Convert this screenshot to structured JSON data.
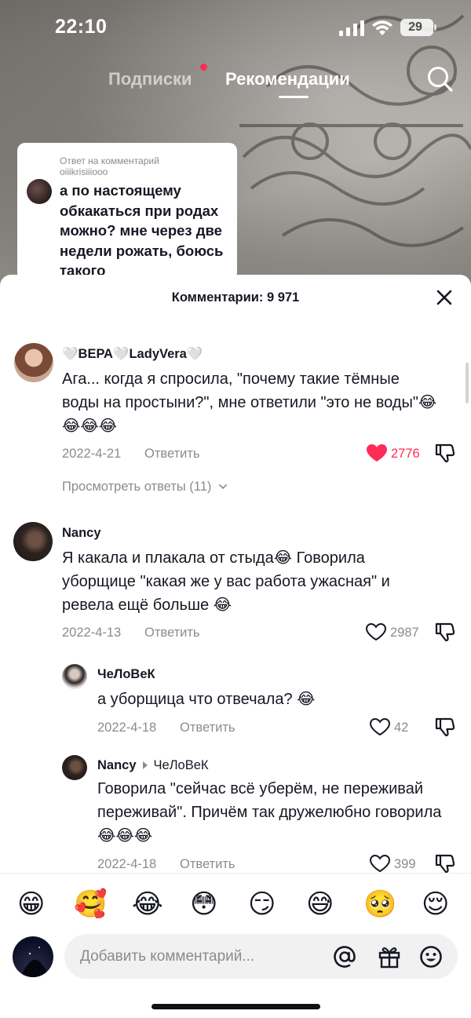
{
  "status_bar": {
    "time": "22:10",
    "battery": "29"
  },
  "top_nav": {
    "following": "Подписки",
    "for_you": "Рекомендации"
  },
  "reply_card": {
    "label": "Ответ на комментарий",
    "username": "oiiikrisiiiooo",
    "text": "а по настоящему обкакаться при родах можно? мне через две недели рожать, боюсь такого"
  },
  "comments_panel": {
    "title": "Комментарии: 9 971",
    "reply_label": "Ответить",
    "comments": [
      {
        "username": "🤍ВЕРА🤍LadyVera🤍",
        "text": "Ага... когда я спросила, \"почему такие тёмные воды на простыни?\", мне ответили \"это не воды\"😂😂😂😂",
        "date": "2022-4-21",
        "likes": "2776",
        "liked": true,
        "view_replies": "Просмотреть ответы (11)"
      },
      {
        "username": "Nancy",
        "text": "Я какала и плакала от стыда😂 Говорила уборщице \"какая же у вас работа ужасная\" и ревела ещё больше 😂",
        "date": "2022-4-13",
        "likes": "2987",
        "liked": false,
        "replies": [
          {
            "username": "ЧеЛоВеК",
            "text": "а уборщица что отвечала? 😂",
            "date": "2022-4-18",
            "likes": "42"
          },
          {
            "username": "Nancy",
            "reply_to": "ЧеЛоВеК",
            "text": "Говорила \"сейчас всё уберём, не переживай переживай\". Причём так дружелюбно говорила😂😂😂",
            "date": "2022-4-18",
            "likes": "399"
          }
        ]
      }
    ]
  },
  "quick_emojis": [
    "😁",
    "🥰",
    "😂",
    "😳",
    "😏",
    "😅",
    "🥺",
    "😌"
  ],
  "comment_input": {
    "placeholder": "Добавить комментарий..."
  },
  "icons": {
    "signal": "cellular-signal-icon",
    "wifi": "wifi-icon",
    "search": "search-icon",
    "close": "close-icon",
    "heart": "heart-icon",
    "dislike": "thumbs-down-icon",
    "chevron": "chevron-down-icon",
    "mention": "at-sign-icon",
    "gift": "gift-icon",
    "emoji": "smiley-icon"
  },
  "colors": {
    "accent": "#fe2c55",
    "secondary_text": "#8a8b91",
    "primary_text": "#161823"
  }
}
